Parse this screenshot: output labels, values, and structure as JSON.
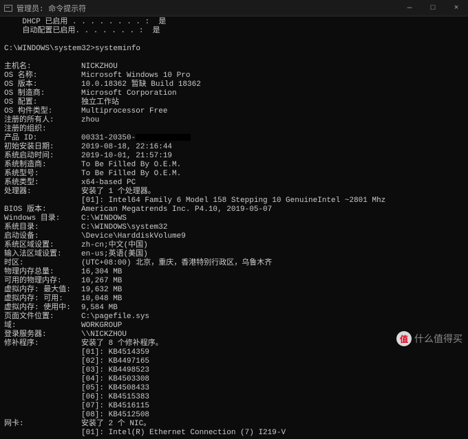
{
  "window": {
    "title": "管理员: 命令提示符",
    "min": "—",
    "max": "□",
    "close": "×"
  },
  "pre_lines": [
    "    DHCP 已启用 . . . . . . . . :  是",
    "    自动配置已启用. . . . . . . :  是",
    "",
    "C:\\WINDOWS\\system32>systeminfo",
    ""
  ],
  "info": [
    {
      "label": "主机名:",
      "value": "NICKZHOU"
    },
    {
      "label": "OS 名称:",
      "value": "Microsoft Windows 10 Pro"
    },
    {
      "label": "OS 版本:",
      "value": "10.0.18362 暂缺 Build 18362"
    },
    {
      "label": "OS 制造商:",
      "value": "Microsoft Corporation"
    },
    {
      "label": "OS 配置:",
      "value": "独立工作站"
    },
    {
      "label": "OS 构件类型:",
      "value": "Multiprocessor Free"
    },
    {
      "label": "注册的所有人:",
      "value": "zhou"
    },
    {
      "label": "注册的组织:",
      "value": ""
    },
    {
      "label": "产品 ID:",
      "value": "00331-20350-",
      "redact": true
    },
    {
      "label": "初始安装日期:",
      "value": "2019-08-18, 22:16:44"
    },
    {
      "label": "系统启动时间:",
      "value": "2019-10-01, 21:57:19"
    },
    {
      "label": "系统制造商:",
      "value": "To Be Filled By O.E.M."
    },
    {
      "label": "系统型号:",
      "value": "To Be Filled By O.E.M."
    },
    {
      "label": "系统类型:",
      "value": "x64-based PC"
    },
    {
      "label": "处理器:",
      "value": "安装了 1 个处理器。"
    },
    {
      "label": "",
      "value": "[01]: Intel64 Family 6 Model 158 Stepping 10 GenuineIntel ~2801 Mhz"
    },
    {
      "label": "BIOS 版本:",
      "value": "American Megatrends Inc. P4.10, 2019-05-07"
    },
    {
      "label": "Windows 目录:",
      "value": "C:\\WINDOWS"
    },
    {
      "label": "系统目录:",
      "value": "C:\\WINDOWS\\system32"
    },
    {
      "label": "启动设备:",
      "value": "\\Device\\HarddiskVolume9"
    },
    {
      "label": "系统区域设置:",
      "value": "zh-cn;中文(中国)"
    },
    {
      "label": "输入法区域设置:",
      "value": "en-us;英语(美国)"
    },
    {
      "label": "时区:",
      "value": "(UTC+08:00) 北京，重庆，香港特别行政区，乌鲁木齐"
    },
    {
      "label": "物理内存总量:",
      "value": "16,304 MB"
    },
    {
      "label": "可用的物理内存:",
      "value": "10,267 MB"
    },
    {
      "label": "虚拟内存: 最大值:",
      "value": "19,632 MB"
    },
    {
      "label": "虚拟内存: 可用:",
      "value": "10,048 MB"
    },
    {
      "label": "虚拟内存: 使用中:",
      "value": "9,584 MB"
    },
    {
      "label": "页面文件位置:",
      "value": "C:\\pagefile.sys"
    },
    {
      "label": "域:",
      "value": "WORKGROUP"
    },
    {
      "label": "登录服务器:",
      "value": "\\\\NICKZHOU"
    },
    {
      "label": "修补程序:",
      "value": "安装了 8 个修补程序。"
    },
    {
      "label": "",
      "value": "[01]: KB4514359"
    },
    {
      "label": "",
      "value": "[02]: KB4497165"
    },
    {
      "label": "",
      "value": "[03]: KB4498523"
    },
    {
      "label": "",
      "value": "[04]: KB4503308"
    },
    {
      "label": "",
      "value": "[05]: KB4508433"
    },
    {
      "label": "",
      "value": "[06]: KB4515383"
    },
    {
      "label": "",
      "value": "[07]: KB4516115"
    },
    {
      "label": "",
      "value": "[08]: KB4512508"
    },
    {
      "label": "网卡:",
      "value": "安装了 2 个 NIC。"
    },
    {
      "label": "",
      "value": "[01]: Intel(R) Ethernet Connection (7) I219-V"
    }
  ],
  "watermark": {
    "badge": "值",
    "text": "什么值得买"
  }
}
